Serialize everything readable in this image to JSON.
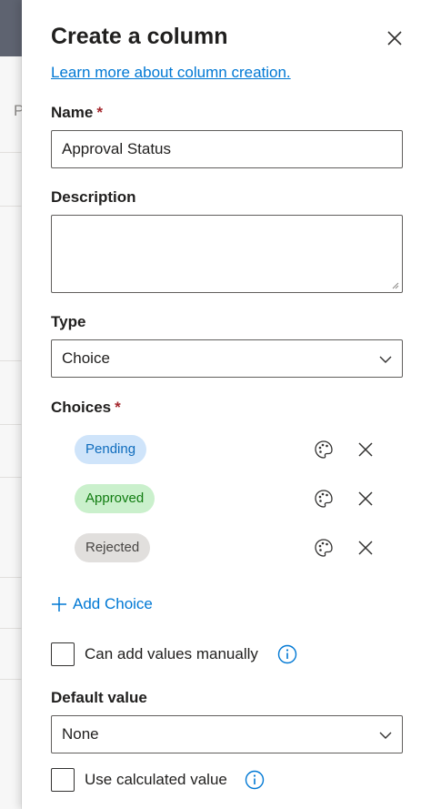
{
  "background": {
    "partial_char": "P"
  },
  "panel": {
    "title": "Create a column",
    "learn_link": "Learn more about column creation.",
    "name": {
      "label": "Name",
      "required_mark": "*",
      "value": "Approval Status"
    },
    "description": {
      "label": "Description",
      "value": ""
    },
    "type": {
      "label": "Type",
      "selected": "Choice"
    },
    "choices": {
      "label": "Choices",
      "required_mark": "*",
      "items": [
        {
          "label": "Pending",
          "color": "#cfe4fa",
          "text_color": "#0f6cbd"
        },
        {
          "label": "Approved",
          "color": "#caf0cc",
          "text_color": "#107c10"
        },
        {
          "label": "Rejected",
          "color": "#e1dfdd",
          "text_color": "#484644"
        }
      ],
      "add_label": "Add Choice"
    },
    "manual_values": {
      "label": "Can add values manually",
      "checked": false
    },
    "default_value": {
      "label": "Default value",
      "selected": "None"
    },
    "calculated": {
      "label": "Use calculated value",
      "checked": false
    }
  },
  "colors": {
    "accent": "#0078d4",
    "required": "#a4262c"
  }
}
